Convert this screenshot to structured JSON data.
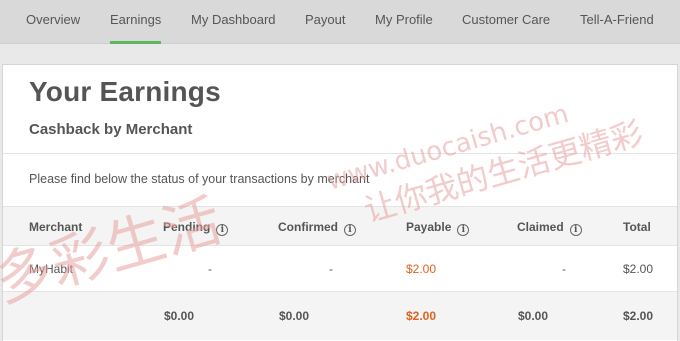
{
  "nav": {
    "items": [
      {
        "label": "Overview"
      },
      {
        "label": "Earnings"
      },
      {
        "label": "My Dashboard"
      },
      {
        "label": "Payout"
      },
      {
        "label": "My Profile"
      },
      {
        "label": "Customer Care"
      },
      {
        "label": "Tell-A-Friend"
      }
    ],
    "active": "Earnings"
  },
  "page": {
    "title": "Your Earnings",
    "subtitle": "Cashback by Merchant",
    "intro": "Please find below the status of your transactions by merchant"
  },
  "table": {
    "headers": {
      "merchant": "Merchant",
      "pending": "Pending",
      "confirmed": "Confirmed",
      "payable": "Payable",
      "claimed": "Claimed",
      "total": "Total"
    },
    "info_icon": "i",
    "rows": [
      {
        "merchant": "MyHabit",
        "pending": "-",
        "confirmed": "-",
        "payable": "$2.00",
        "claimed": "-",
        "total": "$2.00"
      }
    ],
    "totals": {
      "pending": "$0.00",
      "confirmed": "$0.00",
      "payable": "$2.00",
      "claimed": "$0.00",
      "total": "$2.00"
    }
  },
  "watermark": {
    "url": "www.duocaish.com",
    "cn_tagline": "让你我的生活更精彩",
    "cn_logo": "多彩生活"
  },
  "colors": {
    "accent": "#5cb85c",
    "link": "#e0621f",
    "watermark": "#e8a0a0"
  }
}
